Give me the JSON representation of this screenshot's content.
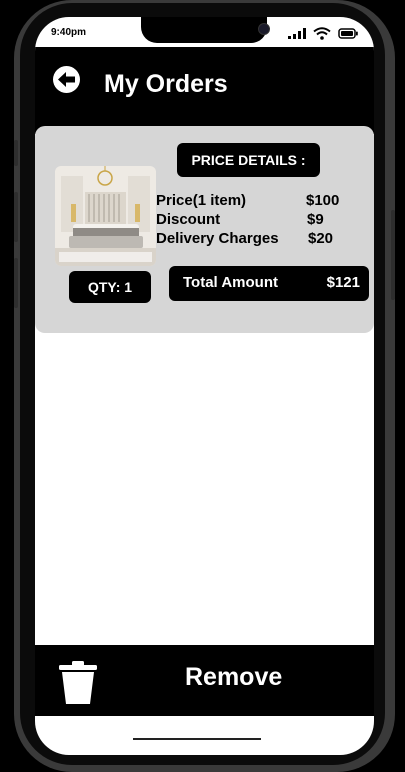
{
  "status_bar": {
    "time": "9:40pm"
  },
  "header": {
    "title": "My Orders",
    "back_icon": "back-arrow-icon"
  },
  "order": {
    "image_alt": "bedroom-product-image",
    "quantity_label": "QTY: 1",
    "price_details_title": "PRICE DETAILS :",
    "rows": [
      {
        "label": "Price(1 item)",
        "value": "$100"
      },
      {
        "label": "Discount",
        "value": "$9"
      },
      {
        "label": "Delivery Charges",
        "value": "$20"
      }
    ],
    "total": {
      "label": "Total Amount",
      "value": "$121"
    }
  },
  "footer": {
    "remove_label": "Remove",
    "trash_icon": "trash-icon"
  },
  "colors": {
    "bar": "#000000",
    "card": "#d6d6d6",
    "screen": "#ffffff"
  }
}
